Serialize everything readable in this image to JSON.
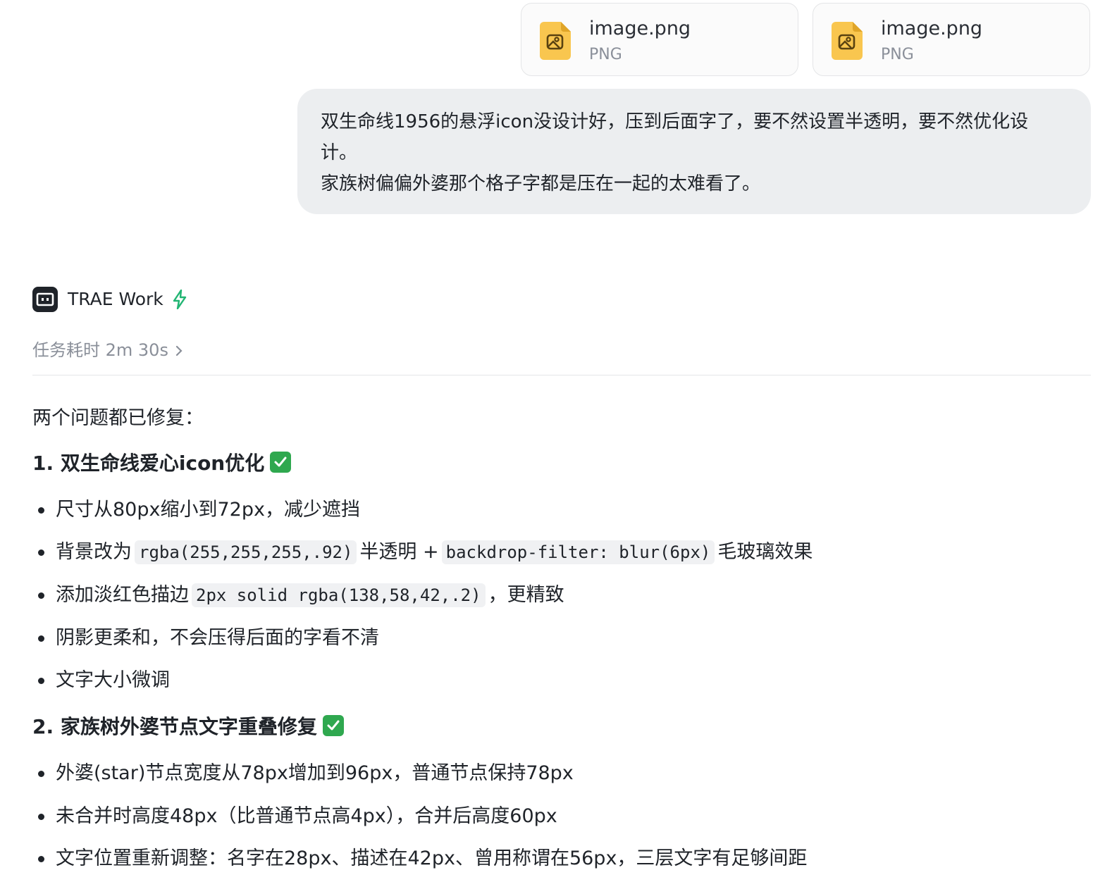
{
  "attachments": [
    {
      "name": "image.png",
      "type": "PNG"
    },
    {
      "name": "image.png",
      "type": "PNG"
    }
  ],
  "user_message": {
    "line1": "双生命线1956的悬浮icon没设计好，压到后面字了，要不然设置半透明，要不然优化设",
    "line2": "计。",
    "line3": "家族树偏偏外婆那个格子字都是压在一起的太难看了。"
  },
  "assistant": {
    "name": "TRAE Work",
    "task_time": "任务耗时 2m 30s"
  },
  "response": {
    "intro": "两个问题都已修复：",
    "section1": {
      "title": "1. 双生命线爱心icon优化",
      "b1": "尺寸从80px缩小到72px，减少遮挡",
      "b2_pre": "背景改为",
      "b2_code1": "rgba(255,255,255,.92)",
      "b2_mid": "半透明 +",
      "b2_code2": "backdrop-filter: blur(6px)",
      "b2_post": "毛玻璃效果",
      "b3_pre": "添加淡红色描边",
      "b3_code": "2px solid rgba(138,58,42,.2)",
      "b3_post": "，更精致",
      "b4": "阴影更柔和，不会压得后面的字看不清",
      "b5": "文字大小微调"
    },
    "section2": {
      "title": "2. 家族树外婆节点文字重叠修复",
      "b1": "外婆(star)节点宽度从78px增加到96px，普通节点保持78px",
      "b2": "未合并时高度48px（比普通节点高4px），合并后高度60px",
      "b3": "文字位置重新调整：名字在28px、描述在42px、曾用称谓在56px，三层文字有足够间距"
    }
  },
  "colors": {
    "file_icon": "#f9c64f",
    "bolt": "#22b573",
    "check": "#2fa84f",
    "bubble": "#eceef0"
  }
}
